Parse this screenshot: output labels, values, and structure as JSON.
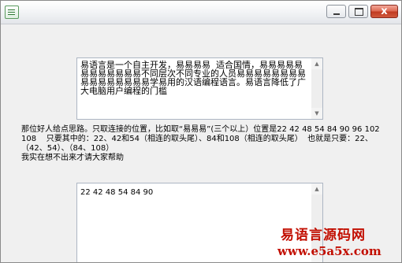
{
  "window": {
    "title": ""
  },
  "title_controls": {
    "minimize": "—",
    "maximize": "□",
    "close": "x"
  },
  "top_edit": {
    "text": "易语言是一个自主开发，易易易易  适合国情，易易易易易易易易易易易易不同层次不同专业的人员易易易易易易易易易易易易易易易易学易用的汉语编程语言。易语言降低了广大电脑用户编程的门槛"
  },
  "instruction": {
    "text": "那位好人给点思路。只取连接的位置，比如取“易易易”(三个以上）位置是22 42 48 54 84 90 96 102 108    只要其中的：22、42和54（相连的取头尾）、84和108（相连的取头尾）  也就是只要：22、（42、54）、（84、108）\n我实在想不出来才请大家帮助"
  },
  "bottom_edit": {
    "text": "22 42 48 54 84 90"
  },
  "watermark": {
    "brand": "易语言源码网",
    "url": "www.e5a5x.com"
  },
  "colors": {
    "watermark": "#c20e00",
    "window_bg": "#f0f0f0",
    "close_button": "#c13c22"
  }
}
